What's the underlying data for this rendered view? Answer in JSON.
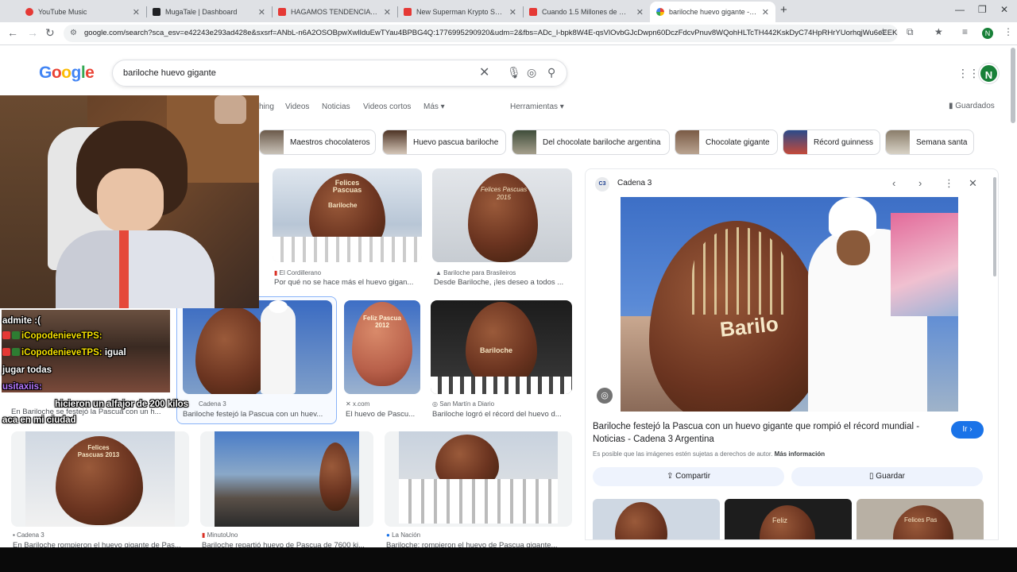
{
  "browser": {
    "tabs": [
      {
        "title": "YouTube Music",
        "favicon_color": "#e53935",
        "active": false
      },
      {
        "title": "MugaTale | Dashboard",
        "favicon_color": "#202124",
        "active": false
      },
      {
        "title": "HAGAMOS TENDENCIA - YouTube",
        "favicon_color": "#e53935",
        "active": false
      },
      {
        "title": "New Superman Krypto Scene (F",
        "favicon_color": "#e53935",
        "active": false
      },
      {
        "title": "Cuando 1.5 Millones de Globos",
        "favicon_color": "#e53935",
        "active": false
      },
      {
        "title": "bariloche huevo gigante - Busc",
        "favicon_color": "#4285f4",
        "active": true
      }
    ],
    "url": "google.com/search?sca_esv=e42243e293ad428e&sxsrf=ANbL-n6A2OSOBpwXwlIduEwTYau4BPBG4Q:1776995290920&udm=2&fbs=ADc_l-bpk8W4E-qsVlOvbGJcDwpn60DczFdcvPnuv8WQohHLTcTH442KskDyC74HpRHrYUorhqjWu6eEEK7...",
    "profile_initial": "N"
  },
  "google": {
    "logo": "Google",
    "query": "bariloche huevo gigante",
    "nav_tabs": [
      "hing",
      "Videos",
      "Noticias",
      "Videos cortos",
      "Más ▾",
      "Herramientas ▾"
    ],
    "saved_label": "Guardados",
    "chips": [
      "Maestros chocolateros",
      "Huevo pascua bariloche",
      "Del chocolate bariloche argentina",
      "Chocolate gigante",
      "Récord guinness",
      "Semana santa"
    ],
    "avatar_initial": "N"
  },
  "results": {
    "row1": [
      {
        "source": "El Cordillerano",
        "caption": "Por qué no se hace más el huevo gigan..."
      },
      {
        "source": "Bariloche para Brasileiros",
        "caption": "Desde Bariloche, ¡les deseo a todos ..."
      }
    ],
    "row2": [
      {
        "source": "Cadena 3",
        "caption": "Bariloche festejó la Pascua con un huev..."
      },
      {
        "source": "x.com",
        "caption": "El huevo de Pascu..."
      },
      {
        "source": "San Martín a Diario",
        "caption": "Bariloche logró el récord del huevo d..."
      }
    ],
    "row2_left_caption": "En Bariloche se festejó la Pascua con un h...",
    "row3": [
      {
        "source": "Cadena 3",
        "caption": "En Bariloche rompieron el huevo gigante de Pas..."
      },
      {
        "source": "MinutoUno",
        "caption": "Bariloche repartió huevo de Pascua de 7600 ki..."
      },
      {
        "source": "La Nación",
        "caption": "Bariloche: rompieron el huevo de Pascua gigante..."
      }
    ],
    "egg_texts": {
      "a": "Felices Pascuas",
      "a2": "Bariloche",
      "b": "Felices Pascuas 2015",
      "c": "Feliz Pascua 2012",
      "d": "Bariloche",
      "e": "Felices Pascuas 2013"
    }
  },
  "preview": {
    "source": "Cadena 3",
    "source_logo": "C3",
    "egg_text": "Barilo",
    "title": "Bariloche festejó la Pascua con un huevo gigante que rompió el récord mundial - Noticias - Cadena 3 Argentina",
    "go_button": "Ir ›",
    "rights_text": "Es posible que las imágenes estén sujetas a derechos de autor.",
    "more_info": "Más información",
    "share_label": "Compartir",
    "save_label": "Guardar",
    "related_texts": [
      "Feliz",
      "Felices Pas"
    ]
  },
  "chat": [
    {
      "user": "",
      "text": "admite :("
    },
    {
      "user": "iCopodenieveTPS:",
      "text": ""
    },
    {
      "user": "iCopodenieveTPS:",
      "text": "igual"
    },
    {
      "user": "",
      "text": "jugar todas"
    },
    {
      "user": "usitaxiis:",
      "text": ""
    },
    {
      "user": "",
      "text": "hicieron un alfajor de 200 kilos"
    },
    {
      "user": "",
      "text": "aca en mi ciudad"
    }
  ],
  "colors": {
    "accent": "#1a73e8",
    "chat_name": "#f5e000",
    "chat_name2": "#b678ff"
  }
}
